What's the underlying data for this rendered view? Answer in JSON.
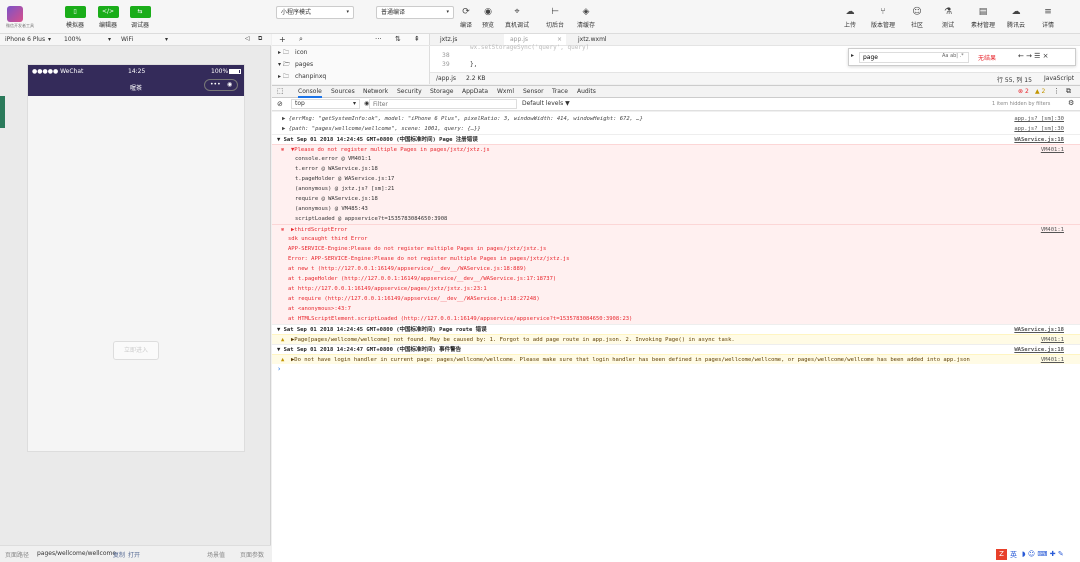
{
  "toolbar": {
    "logo_sub": "微信开发者工具",
    "green_buttons": [
      {
        "icon": "phone-icon",
        "glyph": "▯",
        "label": "模拟器"
      },
      {
        "icon": "code-icon",
        "glyph": "</>",
        "label": "编辑器"
      },
      {
        "icon": "debug-icon",
        "glyph": "⇆",
        "label": "调试器"
      }
    ],
    "mode_select": "小程序模式",
    "compile_select": "普通编译",
    "mid_icons": [
      {
        "icon": "refresh-icon",
        "glyph": "⟳",
        "label": "编译"
      },
      {
        "icon": "eye-icon",
        "glyph": "◉",
        "label": "预览"
      },
      {
        "icon": "device-icon",
        "glyph": "⌖",
        "label": "真机调试"
      },
      {
        "icon": "switch-icon",
        "glyph": "⊢",
        "label": "切后台"
      },
      {
        "icon": "cache-icon",
        "glyph": "◈",
        "label": "清缓存"
      }
    ],
    "right_icons": [
      {
        "icon": "upload-icon",
        "glyph": "☁",
        "label": "上传"
      },
      {
        "icon": "version-icon",
        "glyph": "⑂",
        "label": "版本管理"
      },
      {
        "icon": "community-icon",
        "glyph": "☺",
        "label": "社区"
      },
      {
        "icon": "test-icon",
        "glyph": "⚗",
        "label": "测试"
      },
      {
        "icon": "material-icon",
        "glyph": "▤",
        "label": "素材管理"
      },
      {
        "icon": "cloud-icon",
        "glyph": "☁",
        "label": "腾讯云"
      },
      {
        "icon": "menu-icon",
        "glyph": "≡",
        "label": "详情"
      }
    ]
  },
  "sim": {
    "device": "iPhone 6 Plus",
    "zoom": "100%",
    "network": "WiFi",
    "carrier": "●●●●● WeChat",
    "time": "14:25",
    "battery": "100%",
    "title": "喔茶",
    "capsule_dots": "•••",
    "ghost_button": "立即进入"
  },
  "bottom": {
    "path_label": "页面路径",
    "path": "pages/wellcome/wellcome",
    "copy": "复制",
    "open": "打开",
    "scene": "场景值",
    "params": "页面参数"
  },
  "tree": {
    "tools": [
      "+",
      "⌕",
      "···",
      "⇅",
      "⇞"
    ],
    "items": [
      {
        "glyph": "▸ 🗀",
        "name": "icon"
      },
      {
        "glyph": "▾ 🗁",
        "name": "pages"
      },
      {
        "glyph": "▸ 🗀",
        "name": "chanpinxq"
      }
    ]
  },
  "editor": {
    "tabs": [
      "jxtz.js",
      "app.js",
      "jxtz.wxml"
    ],
    "lines": [
      "38",
      "39"
    ],
    "code": [
      "        wx.setStorageSync('query', query)",
      "      },"
    ],
    "status_left": "/app.js",
    "size": "2.2 KB",
    "status_pos": "行 55, 列 15",
    "language": "JavaScript",
    "find_query": "page",
    "find_opts": "Aa  ab|  .*",
    "find_result": "无结果",
    "find_nav": "← → ☰  ×"
  },
  "devtools": {
    "tabs": [
      "Console",
      "Sources",
      "Network",
      "Security",
      "Storage",
      "AppData",
      "Wxml",
      "Sensor",
      "Trace",
      "Audits"
    ],
    "active_tab": "Console",
    "errors": "2",
    "warnings": "2",
    "context": "top",
    "filter_placeholder": "Filter",
    "levels": "Default levels ▼",
    "hidden": "1 item hidden by filters"
  },
  "console": [
    {
      "type": "log",
      "text": "▶ {errMsg: \"getSystemInfo:ok\", model: \"iPhone 6 Plus\", pixelRatio: 3, windowWidth: 414, windowHeight: 672, …}",
      "src": "app.js? [sm]:30"
    },
    {
      "type": "log",
      "text": "▶ {path: \"pages/wellcome/wellcome\", scene: 1001, query: {…}}",
      "src": "app.js? [sm]:30"
    },
    {
      "type": "hdr",
      "text": "▼ Sat Sep 01 2018 14:24:45 GMT+0800 (中国标准时间) Page 注册错误",
      "src": "WAService.js:18"
    },
    {
      "type": "err",
      "text": "▼Please do not register multiple Pages in pages/jxtz/jxtz.js",
      "src": "VM401:1"
    },
    {
      "type": "trace",
      "text": "console.error @ VM401:1"
    },
    {
      "type": "trace",
      "text": "t.error       @ WAService.js:18"
    },
    {
      "type": "trace",
      "text": "t.pageHolder  @ WAService.js:17"
    },
    {
      "type": "trace",
      "text": "(anonymous)   @ jxtz.js? [sm]:21"
    },
    {
      "type": "trace",
      "text": "require       @ WAService.js:18"
    },
    {
      "type": "trace",
      "text": "(anonymous)   @ VM485:43"
    },
    {
      "type": "trace",
      "text": "scriptLoaded  @ appservice?t=1535783084650:3908"
    },
    {
      "type": "err",
      "text": "▶thirdScriptError",
      "src": "VM401:1"
    },
    {
      "type": "redline",
      "text": "sdk uncaught third Error"
    },
    {
      "type": "redline",
      "text": "APP-SERVICE-Engine:Please do not register multiple Pages in pages/jxtz/jxtz.js"
    },
    {
      "type": "redline",
      "text": "Error: APP-SERVICE-Engine:Please do not register multiple Pages in pages/jxtz/jxtz.js"
    },
    {
      "type": "redline",
      "text": "    at new t (http://127.0.0.1:16149/appservice/__dev__/WAService.js:18:889)"
    },
    {
      "type": "redline",
      "text": "    at t.pageHolder (http://127.0.0.1:16149/appservice/__dev__/WAService.js:17:18737)"
    },
    {
      "type": "redline",
      "text": "    at http://127.0.0.1:16149/appservice/pages/jxtz/jxtz.js:23:1"
    },
    {
      "type": "redline",
      "text": "    at require (http://127.0.0.1:16149/appservice/__dev__/WAService.js:18:27248)"
    },
    {
      "type": "redline",
      "text": "    at <anonymous>:43:7"
    },
    {
      "type": "redline",
      "text": "    at HTMLScriptElement.scriptLoaded (http://127.0.0.1:16149/appservice/appservice?t=1535783084650:3908:23)"
    },
    {
      "type": "hdr",
      "text": "▼ Sat Sep 01 2018 14:24:45 GMT+0800 (中国标准时间) Page route 错误",
      "src": "WAService.js:18"
    },
    {
      "type": "warn",
      "text": "▶Page[pages/wellcome/wellcome] not found. May be caused by: 1. Forgot to add page route in app.json. 2. Invoking Page() in async task.",
      "src": "VM401:1"
    },
    {
      "type": "hdr",
      "text": "▼ Sat Sep 01 2018 14:24:47 GMT+0800 (中国标准时间) 事件警告",
      "src": "WAService.js:18"
    },
    {
      "type": "warn",
      "text": "▶Do not have login handler in current page: pages/wellcome/wellcome. Please make sure that login handler has been defined in pages/wellcome/wellcome, or pages/wellcome/wellcome has been added into app.json",
      "src": "VM401:1"
    },
    {
      "type": "prompt",
      "text": "›"
    }
  ],
  "taskbar": {
    "ime": "英",
    "glyphs": "◗ ☺ ⌨ ✚ ✎"
  },
  "colors": {
    "green": "#1aad19",
    "status_bar": "#342b5a",
    "error": "#e8262d",
    "warning": "#c29500"
  }
}
